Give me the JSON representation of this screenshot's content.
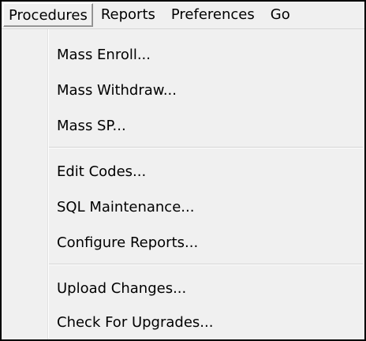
{
  "menubar": {
    "items": [
      {
        "label": "Procedures",
        "active": true
      },
      {
        "label": "Reports"
      },
      {
        "label": "Preferences"
      },
      {
        "label": "Go"
      }
    ]
  },
  "dropdown": {
    "groups": [
      [
        "Mass Enroll...",
        "Mass Withdraw...",
        "Mass SP..."
      ],
      [
        "Edit Codes...",
        "SQL Maintenance...",
        "Configure Reports..."
      ],
      [
        "Upload Changes...",
        "Check For Upgrades..."
      ]
    ]
  }
}
